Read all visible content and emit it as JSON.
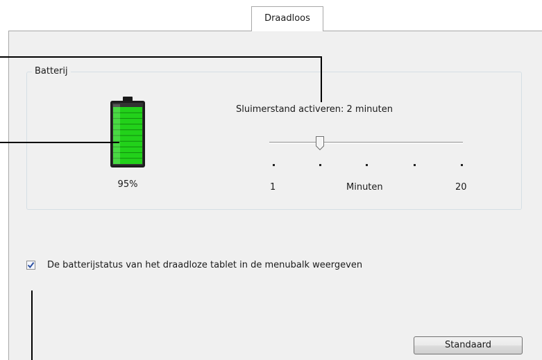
{
  "tabs": [
    {
      "label": "Draadloos",
      "selected": true
    }
  ],
  "battery_group": {
    "title": "Batterij",
    "level_fraction": 0.95,
    "level_label": "95%",
    "fill_color": "#22d11a"
  },
  "sleep_slider": {
    "label": "Sluimerstand activeren: 2 minuten",
    "value_minutes": 2,
    "min_label": "1",
    "unit_label": "Minuten",
    "max_label": "20",
    "tick_count": 5
  },
  "menubar_checkbox": {
    "label": "De batterijstatus van het draadloze tablet in de menubalk weergeven",
    "checked": true
  },
  "default_button": {
    "label": "Standaard"
  }
}
